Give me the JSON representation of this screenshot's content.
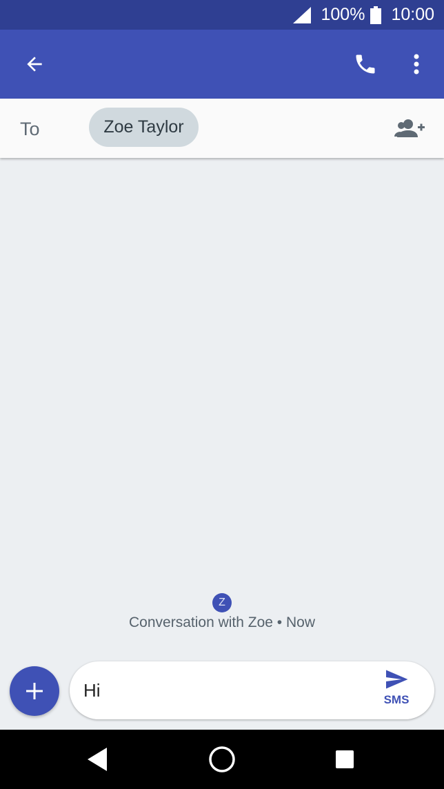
{
  "status_bar": {
    "battery_percent": "100%",
    "time": "10:00",
    "icons": [
      "signal-icon",
      "battery-icon"
    ]
  },
  "app_bar": {
    "icons": [
      "arrow-back-icon",
      "phone-icon",
      "more-vert-icon"
    ],
    "background": "#3f51b5"
  },
  "recipient": {
    "to_label": "To",
    "chip_name": "Zoe Taylor",
    "icon": "add-person-icon"
  },
  "conversation": {
    "avatar_letter": "Z",
    "info_text": "Conversation with Zoe • Now"
  },
  "compose": {
    "message_value": "Hi",
    "send_label": "SMS",
    "icons": [
      "add-icon",
      "send-icon"
    ]
  },
  "nav_bar": {
    "icons": [
      "back-triangle-icon",
      "home-circle-icon",
      "recents-square-icon"
    ]
  },
  "colors": {
    "primary": "#3f51b5",
    "primary_dark": "#2f3f92",
    "background": "#eceff2",
    "chip": "#d0d9de"
  }
}
